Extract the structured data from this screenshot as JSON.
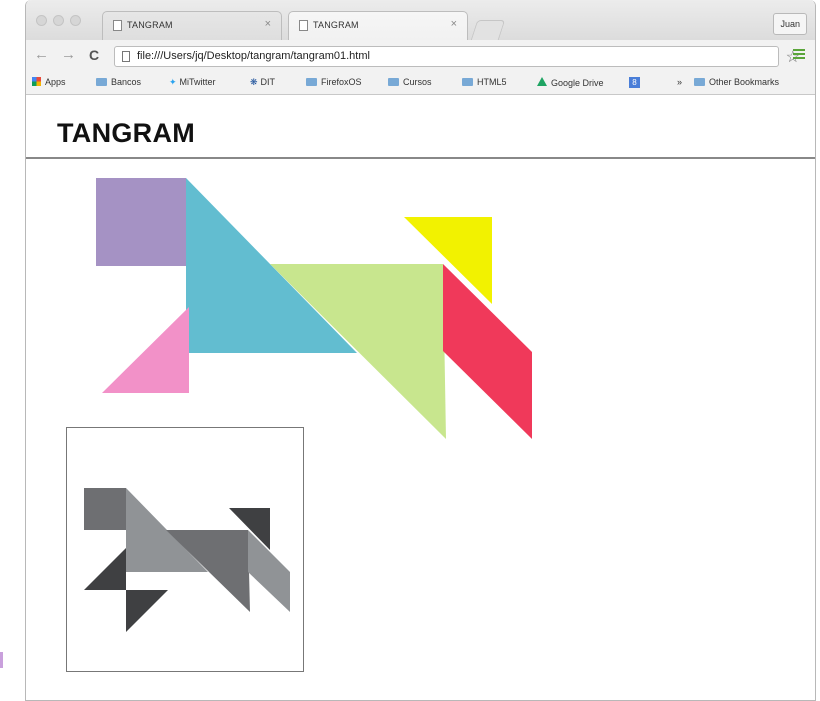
{
  "browser": {
    "tabs": [
      {
        "title": "TANGRAM",
        "close": "×"
      },
      {
        "title": "TANGRAM",
        "close": "×"
      }
    ],
    "profile_name": "Juan",
    "nav": {
      "back": "←",
      "forward": "→",
      "reload": "C"
    },
    "address_bar": {
      "url": "file:///Users/jq/Desktop/tangram/tangram01.html"
    },
    "star_icon": "☆",
    "bookmarks": [
      {
        "label": "Apps",
        "icon": "apps-icon"
      },
      {
        "label": "Bancos",
        "icon": "folder-icon"
      },
      {
        "label": "MiTwitter",
        "icon": "twitter-icon"
      },
      {
        "label": "DIT",
        "icon": "dit-icon"
      },
      {
        "label": "FirefoxOS",
        "icon": "folder-icon"
      },
      {
        "label": "Cursos",
        "icon": "folder-icon"
      },
      {
        "label": "HTML5",
        "icon": "folder-icon"
      },
      {
        "label": "Google Drive",
        "icon": "drive-icon"
      },
      {
        "label": "8",
        "icon": "google-icon"
      }
    ],
    "overflow": "»",
    "other_bookmarks": "Other Bookmarks"
  },
  "page": {
    "title": "TANGRAM"
  },
  "colors": {
    "purple": "#a592c4",
    "cyan": "#62bdd0",
    "green": "#c8e68e",
    "yellow": "#f2f200",
    "red": "#f0395a",
    "pink": "#f291c8",
    "silhouette_dark": "#3f4042",
    "silhouette_mid": "#6e6f72",
    "silhouette_light": "#909396"
  }
}
